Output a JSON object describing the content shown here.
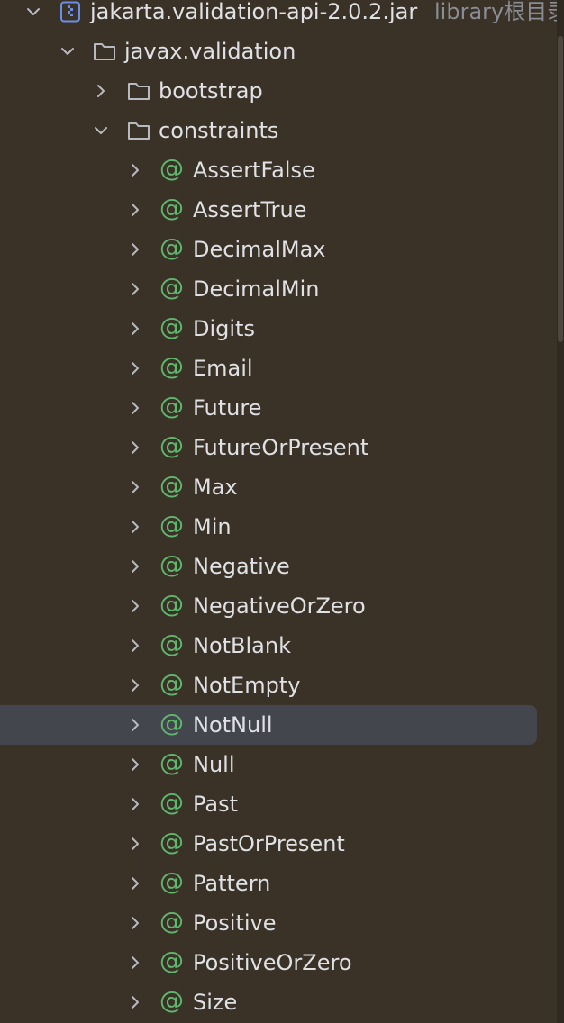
{
  "tree": {
    "root": {
      "label": "jakarta.validation-api-2.0.2.jar",
      "suffix": "library根目录",
      "expanded": true,
      "icon": "jar-archive-icon"
    },
    "package": {
      "label": "javax.validation",
      "expanded": true,
      "icon": "folder-icon"
    },
    "folders": [
      {
        "label": "bootstrap",
        "expanded": false,
        "icon": "folder-icon"
      },
      {
        "label": "constraints",
        "expanded": true,
        "icon": "folder-icon"
      }
    ],
    "annotation_symbol": "@",
    "annotations": [
      {
        "label": "AssertFalse"
      },
      {
        "label": "AssertTrue"
      },
      {
        "label": "DecimalMax"
      },
      {
        "label": "DecimalMin"
      },
      {
        "label": "Digits"
      },
      {
        "label": "Email"
      },
      {
        "label": "Future"
      },
      {
        "label": "FutureOrPresent"
      },
      {
        "label": "Max"
      },
      {
        "label": "Min"
      },
      {
        "label": "Negative"
      },
      {
        "label": "NegativeOrZero"
      },
      {
        "label": "NotBlank"
      },
      {
        "label": "NotEmpty"
      },
      {
        "label": "NotNull",
        "selected": true
      },
      {
        "label": "Null"
      },
      {
        "label": "Past"
      },
      {
        "label": "PastOrPresent"
      },
      {
        "label": "Pattern"
      },
      {
        "label": "Positive"
      },
      {
        "label": "PositiveOrZero"
      },
      {
        "label": "Size"
      }
    ]
  },
  "colors": {
    "background": "#3a3127",
    "selection": "#43464d",
    "text": "#dfe1e5",
    "muted_text": "#8a8d94",
    "annotation_icon": "#5fb86e",
    "jar_icon": "#6b8fe8"
  }
}
